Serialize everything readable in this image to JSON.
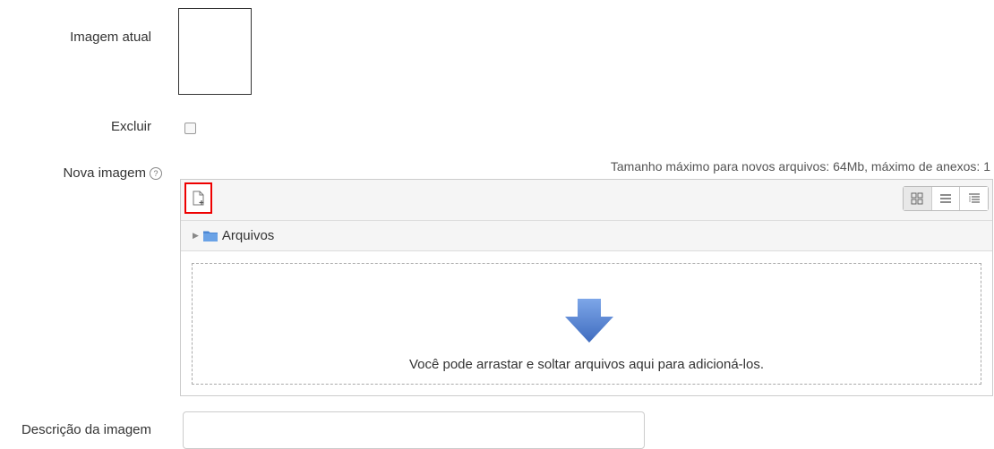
{
  "form": {
    "current_image_label": "Imagem atual",
    "delete_label": "Excluir",
    "new_image_label": "Nova imagem",
    "description_label": "Descrição da imagem"
  },
  "help_icon_glyph": "?",
  "filemanager": {
    "limits_text": "Tamanho máximo para novos arquivos: 64Mb, máximo de anexos: 1",
    "folder_label": "Arquivos",
    "dropzone_text": "Você pode arrastar e soltar arquivos aqui para adicioná-los.",
    "icons": [
      "add-file-icon",
      "icons-view-icon",
      "list-view-icon",
      "tree-view-icon",
      "folder-icon",
      "drop-arrow-icon"
    ]
  },
  "colors": {
    "highlight": "#e00000",
    "arrow": "#4a78c9",
    "folder": "#4a86d4"
  }
}
